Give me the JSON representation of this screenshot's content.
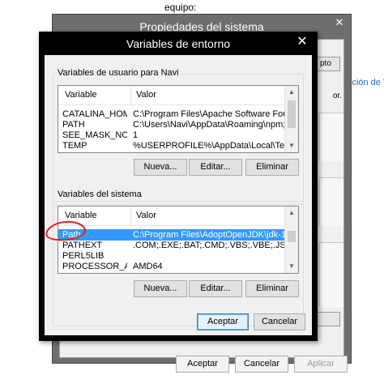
{
  "background": {
    "caption": "equipo:",
    "window_title": "Propiedades del sistema",
    "close_glyph": "✕",
    "side_link": "ición de V",
    "side_tab_text": "pto",
    "side_tab_text2": "or.",
    "buttons": {
      "accept": "Aceptar",
      "cancel": "Cancelar",
      "apply": "Aplicar"
    }
  },
  "dialog": {
    "title": "Variables de entorno",
    "close_glyph": "✕",
    "user_group": {
      "label": "Variables de usuario para Navi",
      "col_variable": "Variable",
      "col_value": "Valor",
      "rows": [
        {
          "name": "CATALINA_HOME",
          "value": "C:\\Program Files\\Apache Software Fou..."
        },
        {
          "name": "PATH",
          "value": "C:\\Users\\Navi\\AppData\\Roaming\\npm;..."
        },
        {
          "name": "SEE_MASK_NOZ...",
          "value": "1"
        },
        {
          "name": "TEMP",
          "value": "%USERPROFILE%\\AppData\\Local\\Temp"
        }
      ],
      "buttons": {
        "new": "Nueva...",
        "edit": "Editar...",
        "delete": "Eliminar"
      }
    },
    "system_group": {
      "label": "Variables del sistema",
      "col_variable": "Variable",
      "col_value": "Valor",
      "rows": [
        {
          "name": "Path",
          "value": "C:\\Program Files\\AdoptOpenJDK\\jdk-11...."
        },
        {
          "name": "PATHEXT",
          "value": ".COM;.EXE;.BAT;.CMD;.VBS;.VBE;.JS;..."
        },
        {
          "name": "PERL5LIB",
          "value": ""
        },
        {
          "name": "PROCESSOR_A...",
          "value": "AMD64"
        }
      ],
      "selected_index": 0,
      "buttons": {
        "new": "Nueva...",
        "edit": "Editar...",
        "delete": "Eliminar"
      }
    },
    "footer": {
      "accept": "Aceptar",
      "cancel": "Cancelar"
    }
  },
  "icons": [
    "close-icon",
    "scroll-up-arrow-icon",
    "scroll-down-arrow-icon"
  ],
  "colors": {
    "selection": "#3399ff",
    "title_bar": "#000000",
    "annotation": "#e0201a",
    "link": "#1e6fc8"
  }
}
